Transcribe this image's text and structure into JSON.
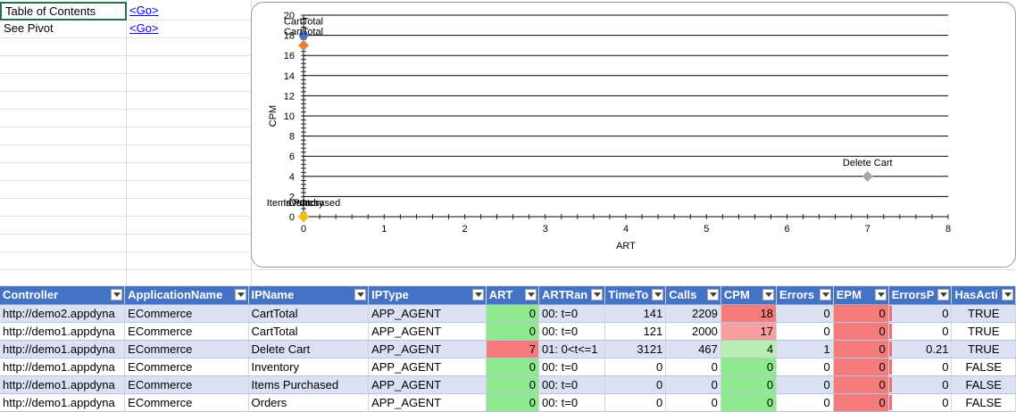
{
  "sheet": {
    "toc_label": "Table of Contents",
    "toc_link": "<Go>",
    "pivot_label": "See Pivot",
    "pivot_link": "<Go>"
  },
  "chart_data": {
    "type": "scatter",
    "xlabel": "ART",
    "ylabel": "CPM",
    "xlim": [
      0,
      8
    ],
    "ylim": [
      0,
      20
    ],
    "xticks": [
      "0",
      "1",
      "2",
      "3",
      "4",
      "5",
      "6",
      "7",
      "8"
    ],
    "yticks": [
      "0",
      "2",
      "4",
      "6",
      "8",
      "10",
      "12",
      "14",
      "16",
      "18",
      "20"
    ],
    "grid": "horizontal",
    "points": [
      {
        "label": "CartTotal",
        "x": 0,
        "y": 18,
        "color": "#4472c4"
      },
      {
        "label": "CartTotal",
        "x": 0,
        "y": 17,
        "color": "#ed7d31"
      },
      {
        "label": "Delete Cart",
        "x": 7,
        "y": 4,
        "color": "#a5a5a5"
      },
      {
        "label": "Inventory",
        "x": 0,
        "y": 0,
        "color": "#ffc000"
      },
      {
        "label": "Items Purchased",
        "x": 0,
        "y": 0,
        "color": "#5b9bd5"
      },
      {
        "label": "Orders",
        "x": 0,
        "y": 0,
        "color": "#70ad47"
      }
    ]
  },
  "table": {
    "columns": [
      "Controller",
      "ApplicationName",
      "IPName",
      "IPType",
      "ART",
      "ARTRan",
      "TimeTo",
      "Calls",
      "CPM",
      "Errors",
      "EPM",
      "ErrorsP",
      "HasActi"
    ],
    "rows": [
      [
        "http://demo2.appdyna",
        "ECommerce",
        "CartTotal",
        "APP_AGENT",
        "0",
        "00: t=0",
        "141",
        "2209",
        "18",
        "0",
        "0",
        "0",
        "TRUE"
      ],
      [
        "http://demo1.appdyna",
        "ECommerce",
        "CartTotal",
        "APP_AGENT",
        "0",
        "00: t=0",
        "121",
        "2000",
        "17",
        "0",
        "0",
        "0",
        "TRUE"
      ],
      [
        "http://demo1.appdyna",
        "ECommerce",
        "Delete Cart",
        "APP_AGENT",
        "7",
        "01: 0<t<=1",
        "3121",
        "467",
        "4",
        "1",
        "0",
        "0.21",
        "TRUE"
      ],
      [
        "http://demo1.appdyna",
        "ECommerce",
        "Inventory",
        "APP_AGENT",
        "0",
        "00: t=0",
        "0",
        "0",
        "0",
        "0",
        "0",
        "0",
        "FALSE"
      ],
      [
        "http://demo1.appdyna",
        "ECommerce",
        "Items Purchased",
        "APP_AGENT",
        "0",
        "00: t=0",
        "0",
        "0",
        "0",
        "0",
        "0",
        "0",
        "FALSE"
      ],
      [
        "http://demo1.appdyna",
        "ECommerce",
        "Orders",
        "APP_AGENT",
        "0",
        "00: t=0",
        "0",
        "0",
        "0",
        "0",
        "0",
        "0",
        "FALSE"
      ]
    ],
    "colors": {
      "header": "#4472c4",
      "band": "#d9e1f2",
      "good": "#8fea8f",
      "bad": "#f57a7a"
    }
  }
}
